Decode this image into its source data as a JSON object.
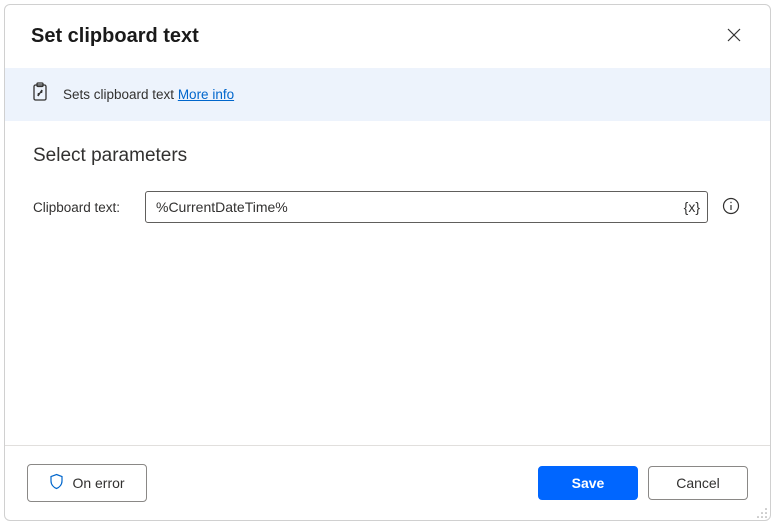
{
  "header": {
    "title": "Set clipboard text"
  },
  "banner": {
    "description": "Sets clipboard text ",
    "more_info_label": "More info"
  },
  "body": {
    "section_title": "Select parameters",
    "clipboard_text": {
      "label": "Clipboard text:",
      "value": "%CurrentDateTime%",
      "variable_btn_text": "{x}"
    }
  },
  "footer": {
    "on_error_label": "On error",
    "save_label": "Save",
    "cancel_label": "Cancel"
  }
}
